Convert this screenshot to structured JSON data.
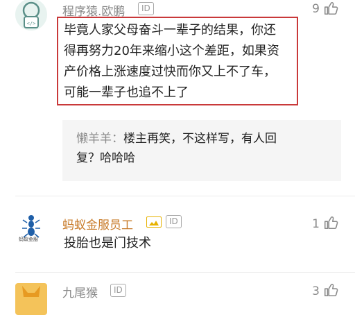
{
  "comments": [
    {
      "username": "程序猿.欧鹏",
      "id_badge": "ID",
      "likes": "9",
      "text_lines": [
        "毕竟人家父母奋斗一辈子的结果，你还",
        "得再努力20年来缩小这个差距，如果资",
        "产价格上涨速度过快而你又上不了车，",
        "可能一辈子也追不上了"
      ],
      "highlighted": true,
      "reply": {
        "author": "懒羊羊：",
        "lines": [
          "楼主再笑，不这样写，有人回",
          "复？哈哈哈"
        ]
      }
    },
    {
      "username": "蚂蚁金服员工",
      "id_badge": "ID",
      "likes": "1",
      "avatar_caption": "蚂蚁金服",
      "text_lines": [
        "投胎也是门技术"
      ]
    },
    {
      "username": "九尾猴",
      "id_badge": "ID",
      "likes": "3"
    }
  ],
  "colors": {
    "username": "#8a8a8a",
    "text": "#222222",
    "highlight_border": "#c9393a",
    "reply_bg": "#f5f5f5",
    "vip_badge": "#e7b200"
  },
  "icons": [
    "avatar-coder",
    "avatar-ant",
    "avatar-fox",
    "thumbs-up-icon",
    "vip-badge-icon"
  ]
}
